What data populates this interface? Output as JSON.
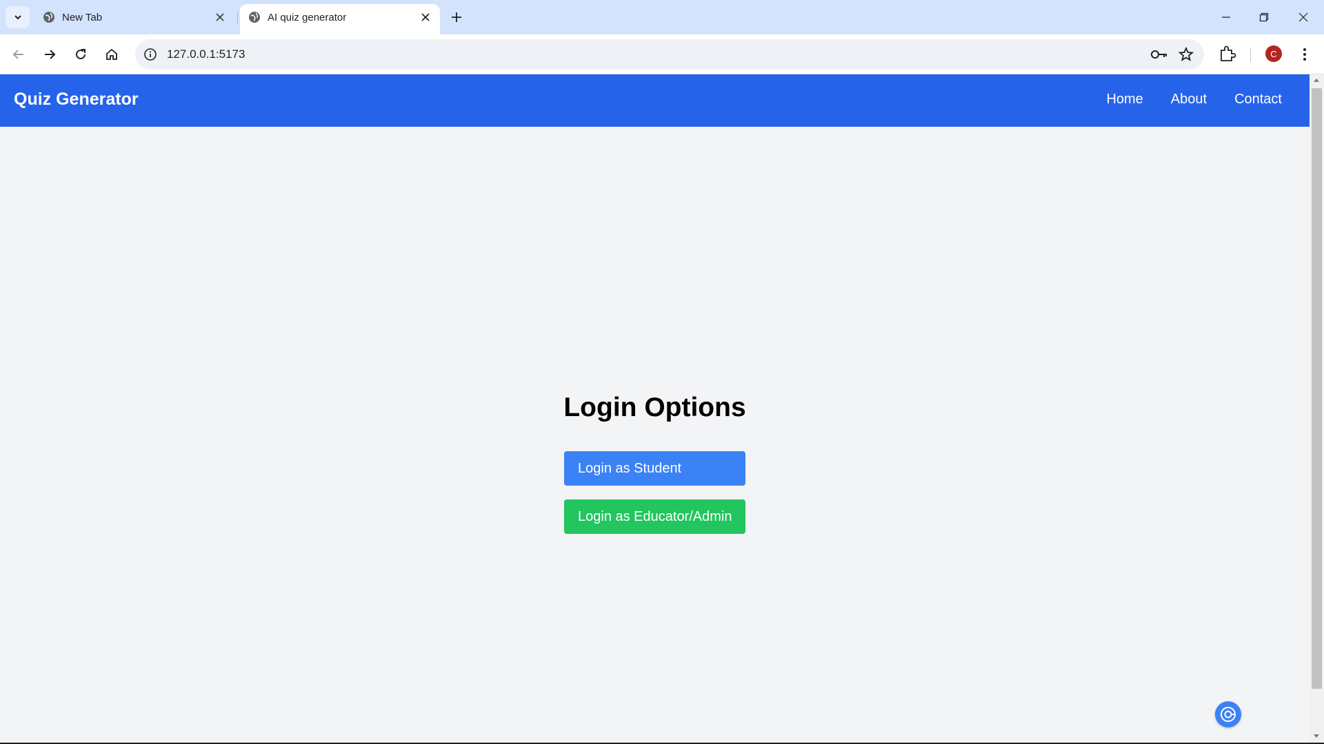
{
  "browser": {
    "tabs": [
      {
        "title": "New Tab",
        "active": false,
        "favicon": "globe-icon"
      },
      {
        "title": "AI quiz generator",
        "active": true,
        "favicon": "globe-icon"
      }
    ],
    "url": "127.0.0.1:5173",
    "profile_initial": "C",
    "colors": {
      "tabstrip": "#d3e3fd",
      "active_tab": "#ffffff",
      "avatar": "#b3261e"
    }
  },
  "page": {
    "brand": "Quiz Generator",
    "nav": [
      "Home",
      "About",
      "Contact"
    ],
    "login_title": "Login Options",
    "buttons": {
      "student": "Login as Student",
      "educator": "Login as Educator/Admin"
    },
    "colors": {
      "navbar": "#2563eb",
      "student_button": "#3b82f6",
      "educator_button": "#22c55e",
      "background": "#f3f4f6"
    }
  }
}
